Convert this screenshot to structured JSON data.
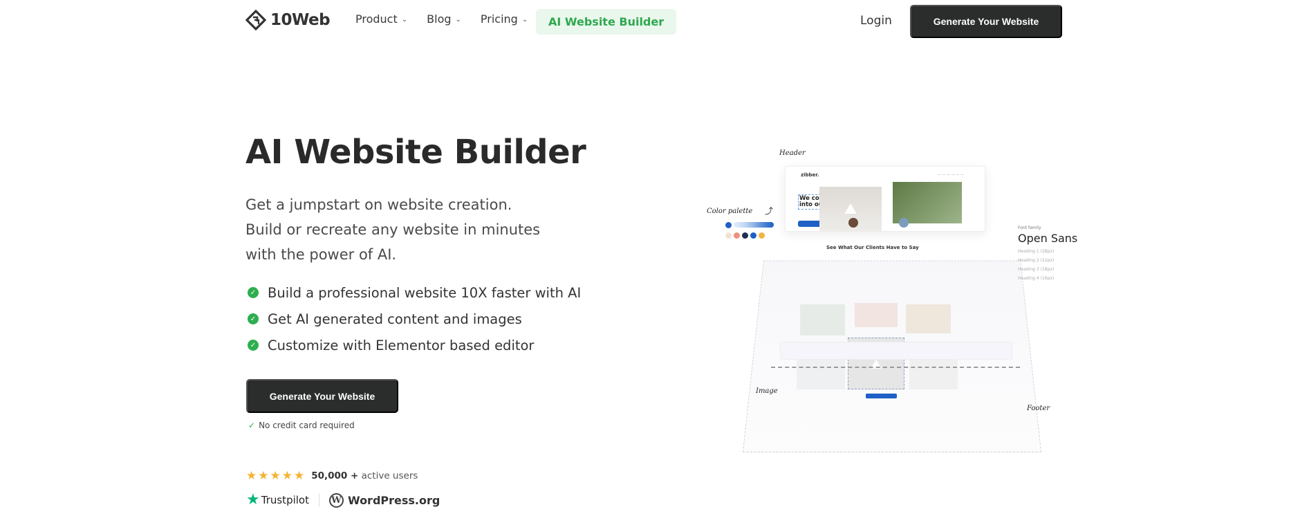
{
  "nav": {
    "brand": "10Web",
    "menu": [
      {
        "label": "Product",
        "has_dropdown": true
      },
      {
        "label": "Blog",
        "has_dropdown": true
      },
      {
        "label": "Pricing",
        "has_dropdown": true
      }
    ],
    "highlight": "AI Website Builder",
    "login": "Login",
    "cta": "Generate Your Website",
    "dropdown_icon": "chevron-down-icon"
  },
  "hero": {
    "title": "AI Website Builder",
    "subtitle_lines": [
      "Get a jumpstart on website creation.",
      "Build or recreate any website in minutes",
      "with the power of AI."
    ],
    "features": [
      "Build a professional website 10X faster with AI",
      "Get AI generated content and images",
      "Customize with Elementor based editor"
    ],
    "cta": "Generate Your Website",
    "cta_note": "No credit card required",
    "rating_stars": 5,
    "users_count": "50,000 +",
    "users_label": "active users",
    "badges": [
      "Trustpilot",
      "WordPress.org"
    ]
  },
  "illustration": {
    "mock_brand": "zibber.",
    "mock_heading": "We convert potential into outcomes.",
    "clients_title": "See What Our Clients Have to Say",
    "labels": {
      "header": "Header",
      "color_palette": "Color palette",
      "font_family_caption": "Font family",
      "font_family": "Open Sans",
      "image": "Image",
      "footer": "Footer"
    },
    "heading_samples": [
      "Heading 1 (28px)",
      "Heading 2 (22px)",
      "Heading 3 (18px)",
      "Heading 4 (16px)"
    ],
    "palette_colors": [
      "#f3e2d2",
      "#ee8f7f",
      "#1f2f4f",
      "#1e60c6",
      "#f2b540"
    ],
    "gradient_colors": [
      "#e3eefb",
      "#c5dbf4",
      "#8fb6e6",
      "#4f86d2",
      "#1e60c6"
    ]
  },
  "colors": {
    "dark_button": "#2b2c2c",
    "accent_green": "#2fa84f",
    "accent_green_bg": "#e9f7ec",
    "star": "#f5b333",
    "trustpilot": "#04b67b"
  }
}
